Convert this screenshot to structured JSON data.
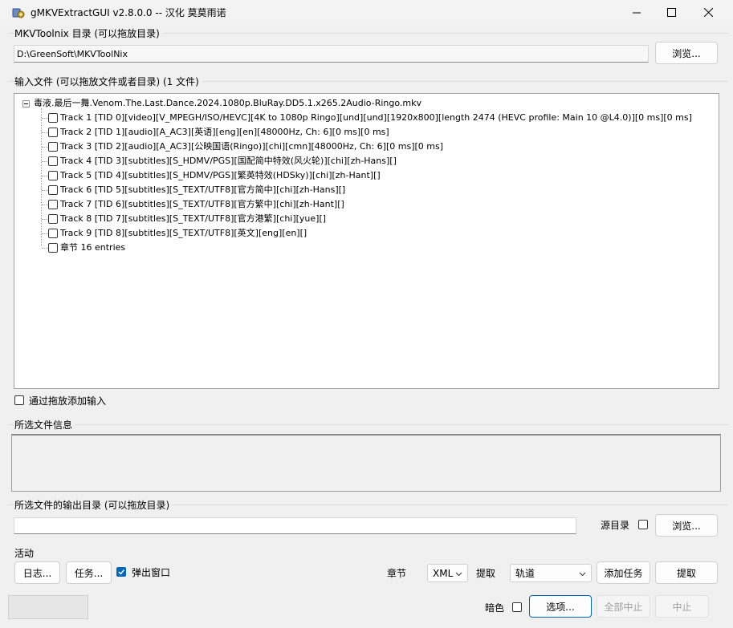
{
  "window": {
    "title": "gMKVExtractGUI v2.8.0.0 -- 汉化 莫莫雨诺",
    "controls": [
      "minimize-icon",
      "maximize-icon",
      "close-icon"
    ]
  },
  "mkvtoolnix": {
    "group_label": "MKVToolnix 目录 (可以拖放目录)",
    "path": "D:\\GreenSoft\\MKVToolNix",
    "browse_label": "浏览..."
  },
  "input": {
    "group_label": "输入文件 (可以拖放文件或者目录) (1 文件)",
    "file_name": "毒液.最后一舞.Venom.The.Last.Dance.2024.1080p.BluRay.DD5.1.x265.2Audio-Ringo.mkv",
    "tracks": [
      "Track 1 [TID 0][video][V_MPEGH/ISO/HEVC][4K to 1080p Ringo][und][und][1920x800][length 2474 (HEVC profile: Main 10 @L4.0)][0 ms][0 ms]",
      "Track 2 [TID 1][audio][A_AC3][英语][eng][en][48000Hz, Ch: 6][0 ms][0 ms]",
      "Track 3 [TID 2][audio][A_AC3][公映国语(Ringo)][chi][cmn][48000Hz, Ch: 6][0 ms][0 ms]",
      "Track 4 [TID 3][subtitles][S_HDMV/PGS][国配简中特效(风火轮)][chi][zh-Hans][]",
      "Track 5 [TID 4][subtitles][S_HDMV/PGS][繁英特效(HDSky)][chi][zh-Hant][]",
      "Track 6 [TID 5][subtitles][S_TEXT/UTF8][官方简中][chi][zh-Hans][]",
      "Track 7 [TID 6][subtitles][S_TEXT/UTF8][官方繁中][chi][zh-Hant][]",
      "Track 8 [TID 7][subtitles][S_TEXT/UTF8][官方港繁][chi][yue][]",
      "Track 9 [TID 8][subtitles][S_TEXT/UTF8][英文][eng][en][]",
      "章节 16 entries"
    ],
    "drag_add_label": "通过拖放添加输入"
  },
  "file_info": {
    "group_label": "所选文件信息"
  },
  "output": {
    "group_label": "所选文件的输出目录 (可以拖放目录)",
    "path": "",
    "source_dir_label": "源目录",
    "browse_label": "浏览..."
  },
  "actions": {
    "group_label": "活动",
    "log_label": "日志...",
    "jobs_label": "任务...",
    "popup_label": "弹出窗口",
    "popup_checked": true,
    "chapters_label": "章节",
    "chapters_format": "XML",
    "extract_label": "提取",
    "extract_mode": "轨道",
    "add_job_label": "添加任务",
    "extract_button_label": "提取"
  },
  "statusbar": {
    "dark_label": "暗色",
    "options_label": "选项...",
    "abort_all_label": "全部中止",
    "abort_label": "中止"
  },
  "colors": {
    "accent": "#0067c0",
    "window_bg": "#f0f0f0"
  }
}
